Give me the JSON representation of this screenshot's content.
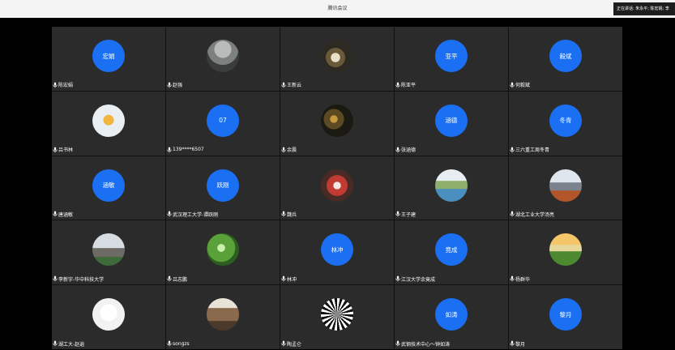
{
  "window": {
    "title": "腾讯会议"
  },
  "speaking_indicator": "正在讲话: 朱永平; 陈宏娟; 李",
  "participants": [
    {
      "name": "陈宏娟",
      "avatar_text": "宏娟",
      "avatar_type": "initials",
      "color": "#1a6ff3"
    },
    {
      "name": "赵强",
      "avatar_text": "",
      "avatar_type": "photo",
      "photo": "landscape-photo"
    },
    {
      "name": "王新云",
      "avatar_text": "",
      "avatar_type": "photo",
      "photo": "food-photo"
    },
    {
      "name": "陈亚平",
      "avatar_text": "亚平",
      "avatar_type": "initials",
      "color": "#1a6ff3"
    },
    {
      "name": "何毅斌",
      "avatar_text": "毅斌",
      "avatar_type": "initials",
      "color": "#1a6ff3"
    },
    {
      "name": "吕书林",
      "avatar_text": "",
      "avatar_type": "photo",
      "photo": "cartoon-portrait"
    },
    {
      "name": "139****6507",
      "avatar_text": "07",
      "avatar_type": "initials",
      "color": "#1a6ff3"
    },
    {
      "name": "余震",
      "avatar_text": "",
      "avatar_type": "photo",
      "photo": "dark-scene-photo"
    },
    {
      "name": "张涵德",
      "avatar_text": "涵德",
      "avatar_type": "initials",
      "color": "#1a6ff3"
    },
    {
      "name": "三六重工周冬青",
      "avatar_text": "冬青",
      "avatar_type": "initials",
      "color": "#1a6ff3"
    },
    {
      "name": "唐涵敏",
      "avatar_text": "涵敏",
      "avatar_type": "initials",
      "color": "#1a6ff3"
    },
    {
      "name": "武汉理工大学-谭跃刚",
      "avatar_text": "跃刚",
      "avatar_type": "initials",
      "color": "#1a6ff3"
    },
    {
      "name": "魏兵",
      "avatar_text": "",
      "avatar_type": "photo",
      "photo": "red-object-photo"
    },
    {
      "name": "王子建",
      "avatar_text": "",
      "avatar_type": "photo",
      "photo": "river-photo"
    },
    {
      "name": "湖北工业大学汤亮",
      "avatar_text": "",
      "avatar_type": "photo",
      "photo": "city-photo"
    },
    {
      "name": "李新宇-华中科技大学",
      "avatar_text": "",
      "avatar_type": "photo",
      "photo": "castle-photo"
    },
    {
      "name": "吕志鹏",
      "avatar_text": "",
      "avatar_type": "photo",
      "photo": "leaves-photo"
    },
    {
      "name": "林冲",
      "avatar_text": "林冲",
      "avatar_type": "initials",
      "color": "#1a6ff3"
    },
    {
      "name": "江汉大学余竟成",
      "avatar_text": "竟成",
      "avatar_type": "initials",
      "color": "#1a6ff3"
    },
    {
      "name": "杨群华",
      "avatar_text": "",
      "avatar_type": "photo",
      "photo": "sunset-field-photo"
    },
    {
      "name": "湖工大-赵逍",
      "avatar_text": "",
      "avatar_type": "photo",
      "photo": "doodle-photo"
    },
    {
      "name": "songzs",
      "avatar_text": "",
      "avatar_type": "photo",
      "photo": "person-photo"
    },
    {
      "name": "陶孟仑",
      "avatar_text": "",
      "avatar_type": "photo",
      "photo": "pattern-photo"
    },
    {
      "name": "武钢技术中心～钟如涛",
      "avatar_text": "如涛",
      "avatar_type": "initials",
      "color": "#1a6ff3"
    },
    {
      "name": "黎月",
      "avatar_text": "黎月",
      "avatar_type": "initials",
      "color": "#1a6ff3"
    }
  ]
}
